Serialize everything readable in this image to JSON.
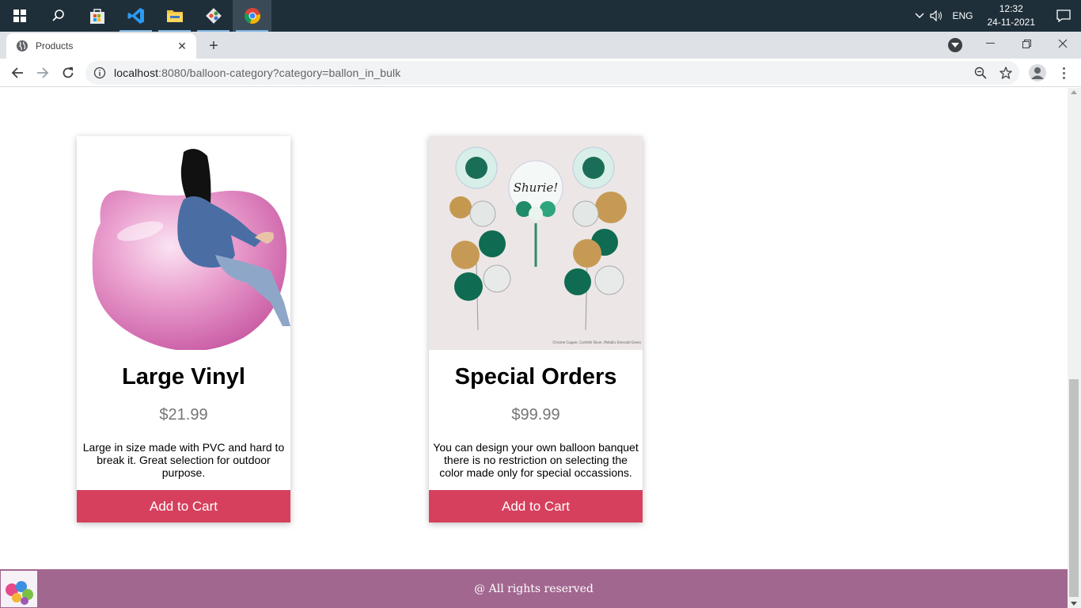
{
  "taskbar": {
    "apps": [
      {
        "name": "start-button"
      },
      {
        "name": "search-button"
      },
      {
        "name": "store-app"
      },
      {
        "name": "vscode-app"
      },
      {
        "name": "file-explorer-app"
      },
      {
        "name": "git-app"
      },
      {
        "name": "chrome-app"
      }
    ],
    "language": "ENG",
    "time": "12:32",
    "date": "24-11-2021"
  },
  "browser": {
    "tab_title": "Products",
    "url_host": "localhost",
    "url_rest": ":8080/balloon-category?category=ballon_in_bulk"
  },
  "products": [
    {
      "title": "Large Vinyl",
      "price": "$21.99",
      "description": "Large in size made with PVC and hard to break it. Great selection for outdoor purpose.",
      "button": "Add to Cart"
    },
    {
      "title": "Special Orders",
      "price": "$99.99",
      "description": "You can design your own balloon banquet there is no restriction on selecting the color made only for special occassions.",
      "button": "Add to Cart",
      "image_caption": "Chrome Copper, Confetti Silver, Metallic Emerald Green",
      "balloon_text": "Shurie!"
    }
  ],
  "footer": {
    "text": "@ All rights reserved"
  },
  "colors": {
    "button": "#d6405d",
    "footer": "#a2678f",
    "taskbar": "#1f2f3a"
  }
}
